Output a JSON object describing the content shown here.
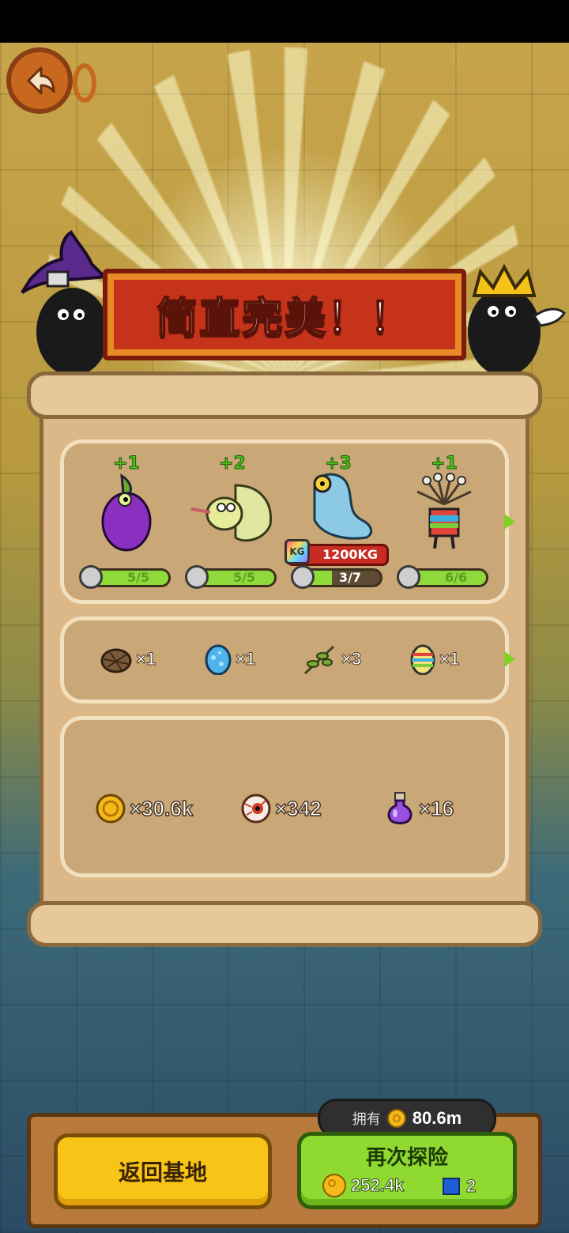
{
  "banner": {
    "title": "简直完美！！"
  },
  "monsters": [
    {
      "name": "eggplant-monster",
      "plus": "+1",
      "progress_text": "5/5",
      "progress": 1.0
    },
    {
      "name": "cabbage-monster",
      "plus": "+2",
      "progress_text": "5/5",
      "progress": 1.0
    },
    {
      "name": "chameleon-monster",
      "plus": "+3",
      "progress_text": "3/7",
      "progress": 0.4286,
      "weight": "1200KG"
    },
    {
      "name": "mushroom-monster",
      "plus": "+1",
      "progress_text": "6/6",
      "progress": 1.0
    }
  ],
  "items": [
    {
      "icon": "nest-icon",
      "count": "×1"
    },
    {
      "icon": "blue-egg-icon",
      "count": "×1"
    },
    {
      "icon": "herb-icon",
      "count": "×3"
    },
    {
      "icon": "rainbow-egg-icon",
      "count": "×1"
    }
  ],
  "rewards": [
    {
      "icon": "coin-icon",
      "count": "×30.6k"
    },
    {
      "icon": "eyeball-icon",
      "count": "×342"
    },
    {
      "icon": "potion-icon",
      "count": "×16"
    }
  ],
  "wallet": {
    "label": "拥有",
    "value": "80.6m"
  },
  "buttons": {
    "return_label": "返回基地",
    "explore_label": "再次探险",
    "explore_coin_cost": "252.4k",
    "explore_gem_cost": "2"
  },
  "colors": {
    "accent_green": "#8fd930",
    "accent_yellow": "#f8c417",
    "banner_red": "#c6331b"
  }
}
